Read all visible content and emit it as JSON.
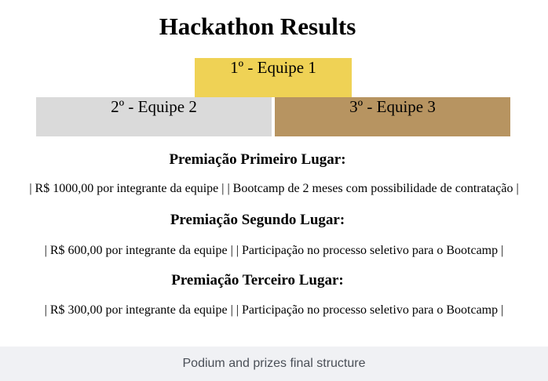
{
  "page": {
    "title": "Hackathon Results"
  },
  "podium": {
    "first": {
      "label": "1º - Equipe 1",
      "color": "#efd255"
    },
    "second": {
      "label": "2º - Equipe 2",
      "color": "#dadada"
    },
    "third": {
      "label": "3º - Equipe 3",
      "color": "#b79461"
    }
  },
  "prizes": [
    {
      "heading": "Premiação Primeiro Lugar:",
      "line": "| R$ 1000,00 por integrante da equipe | | Bootcamp de 2 meses com possibilidade de contratação |"
    },
    {
      "heading": "Premiação Segundo Lugar:",
      "line": "| R$ 600,00 por integrante da equipe | | Participação no processo seletivo para o Bootcamp |"
    },
    {
      "heading": "Premiação Terceiro Lugar:",
      "line": "| R$ 300,00 por integrante da equipe | | Participação no processo seletivo para o Bootcamp |"
    }
  ],
  "caption": "Podium and prizes final structure"
}
